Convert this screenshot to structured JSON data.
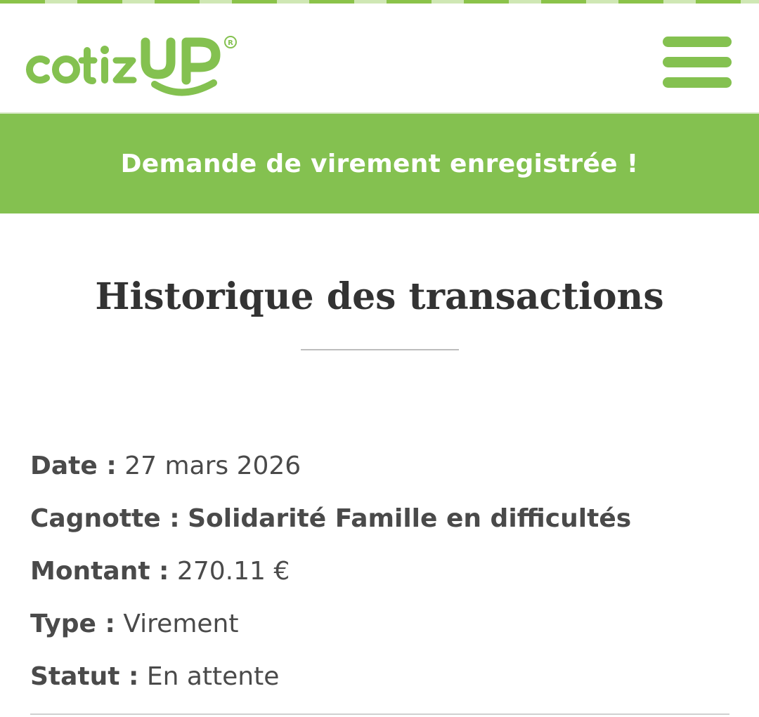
{
  "brand": {
    "logo_text": "cotizUP",
    "registered_mark": "®",
    "accent_color": "#84c150"
  },
  "header": {
    "menu_icon": "hamburger-menu-icon"
  },
  "banner": {
    "message": "Demande de virement enregistrée !"
  },
  "main": {
    "title": "Historique des transactions",
    "transaction": {
      "date_label": "Date :",
      "date_value": "27 mars 2026",
      "cagnotte_label": "Cagnotte :",
      "cagnotte_value": "Solidarité Famille en difficultés",
      "montant_label": "Montant :",
      "montant_value": "270.11 €",
      "type_label": "Type :",
      "type_value": "Virement",
      "statut_label": "Statut :",
      "statut_value": "En attente"
    }
  }
}
